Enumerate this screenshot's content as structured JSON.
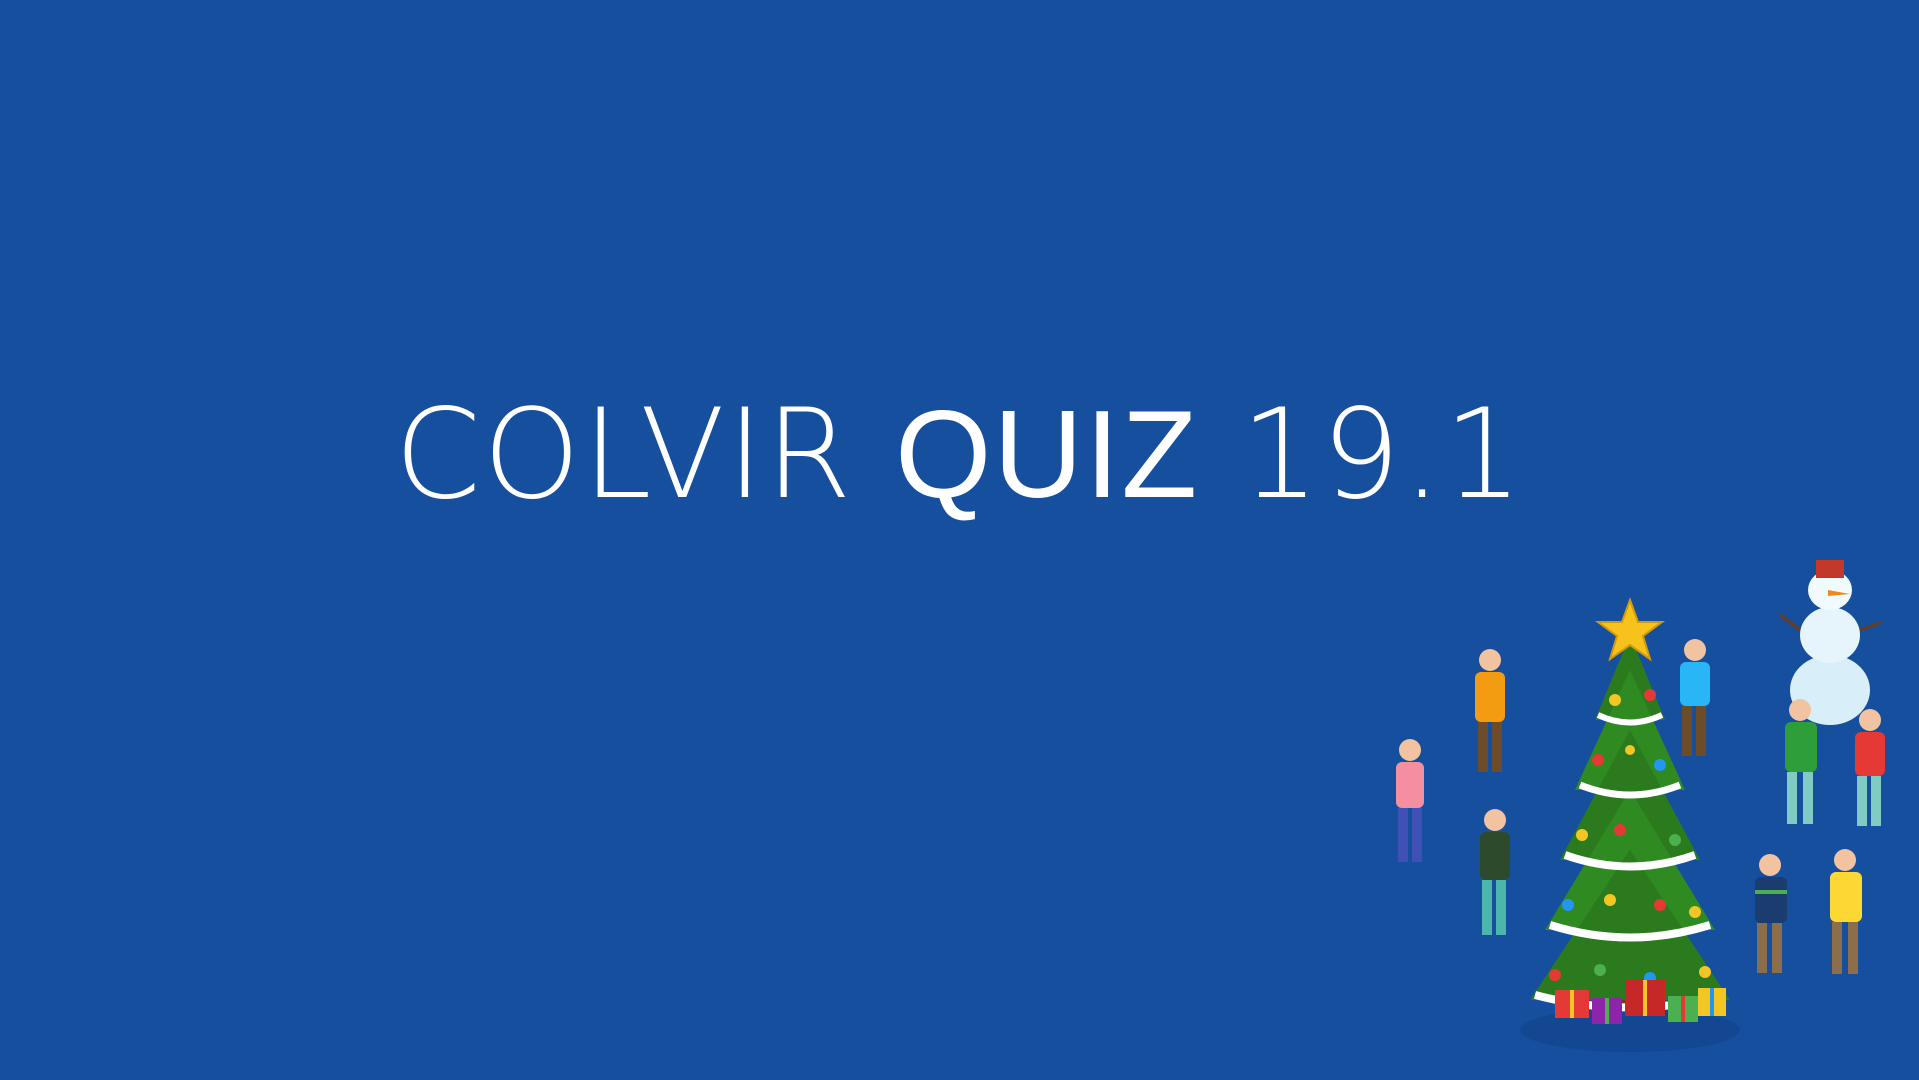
{
  "slide": {
    "background_color": "#174f9f",
    "title": {
      "part1": "COLVIR",
      "part2": "QUIZ",
      "part3": "19.1",
      "color": "#ffffff"
    },
    "illustration": {
      "icon": "christmas-party-illustration",
      "elements": [
        "christmas-tree",
        "star",
        "snowman",
        "gift-boxes",
        "people"
      ]
    }
  }
}
